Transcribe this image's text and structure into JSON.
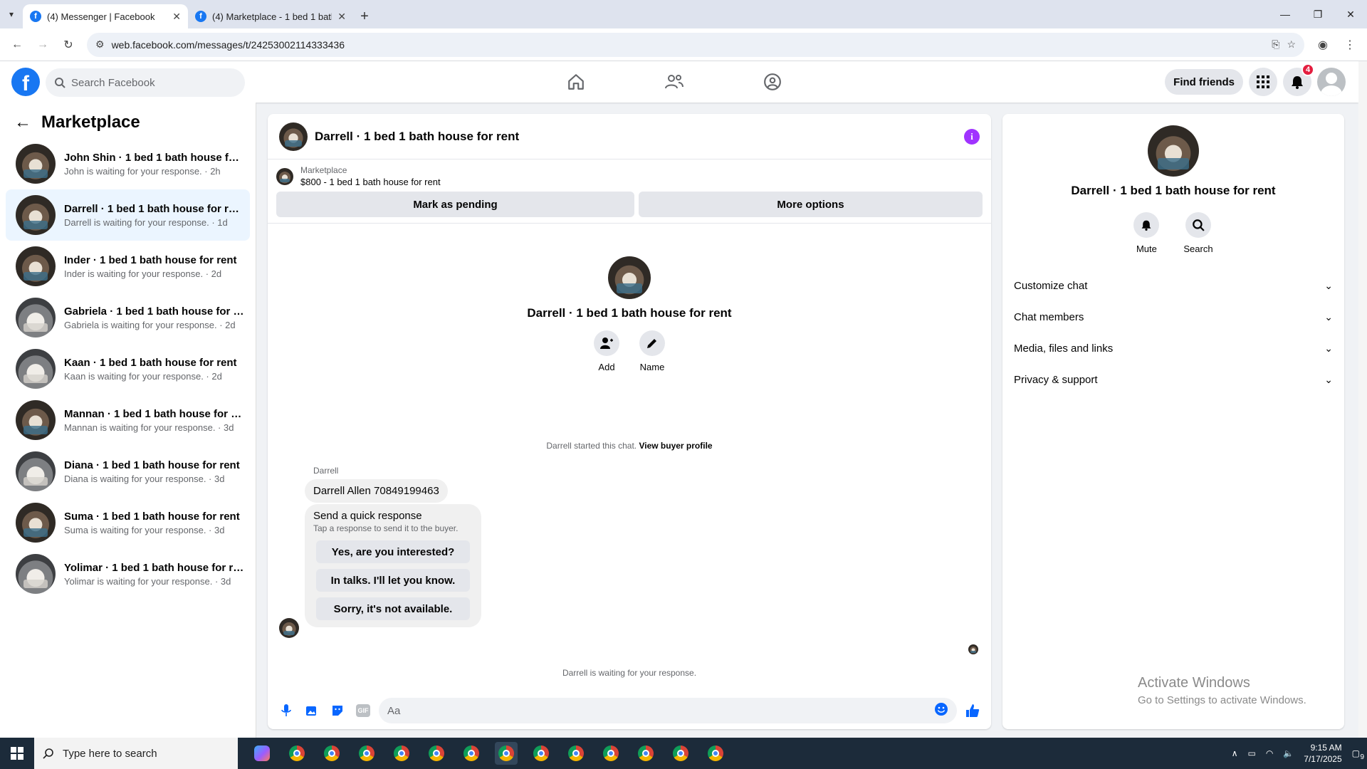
{
  "browser": {
    "tabs": [
      {
        "title": "(4) Messenger | Facebook",
        "active": true
      },
      {
        "title": "(4) Marketplace - 1 bed 1 bath",
        "active": false
      }
    ],
    "url": "web.facebook.com/messages/t/24253002114333436"
  },
  "header": {
    "search_placeholder": "Search Facebook",
    "find_friends": "Find friends",
    "notification_count": "4"
  },
  "sidebar": {
    "title": "Marketplace",
    "conversations": [
      {
        "name": "John Shin · 1 bed 1 bath house for ...",
        "sub": "John is waiting for your response. · 2h"
      },
      {
        "name": "Darrell · 1 bed 1 bath house for rent",
        "sub": "Darrell is waiting for your response. · 1d"
      },
      {
        "name": "Inder · 1 bed 1 bath house for rent",
        "sub": "Inder is waiting for your response. · 2d"
      },
      {
        "name": "Gabriela · 1 bed 1 bath house for r...",
        "sub": "Gabriela is waiting for your response. · 2d"
      },
      {
        "name": "Kaan · 1 bed 1 bath house for rent",
        "sub": "Kaan is waiting for your response. · 2d"
      },
      {
        "name": "Mannan · 1 bed 1 bath house for re...",
        "sub": "Mannan is waiting for your response. · 3d"
      },
      {
        "name": "Diana · 1 bed 1 bath house for rent",
        "sub": "Diana is waiting for your response. · 3d"
      },
      {
        "name": "Suma · 1 bed 1 bath house for rent",
        "sub": "Suma is waiting for your response. · 3d"
      },
      {
        "name": "Yolimar · 1 bed 1 bath house for rent",
        "sub": "Yolimar is waiting for your response. · 3d"
      }
    ]
  },
  "chat": {
    "title": "Darrell · 1 bed 1 bath house for rent",
    "marketplace_label": "Marketplace",
    "listing": "$800 - 1 bed 1 bath house for rent",
    "mark_pending": "Mark as pending",
    "more_options": "More options",
    "intro_name": "Darrell · 1 bed 1 bath house for rent",
    "add_label": "Add",
    "name_label": "Name",
    "started_text": "Darrell started this chat.",
    "view_profile": "View buyer profile",
    "sender": "Darrell",
    "message": "Darrell Allen 70849199463",
    "quick_title": "Send a quick response",
    "quick_sub": "Tap a response to send it to the buyer.",
    "quick_options": [
      "Yes, are you interested?",
      "In talks. I'll let you know.",
      "Sorry, it's not available."
    ],
    "waiting": "Darrell is waiting for your response.",
    "composer_placeholder": "Aa",
    "gif_label": "GIF"
  },
  "info": {
    "name": "Darrell · 1 bed 1 bath house for rent",
    "mute": "Mute",
    "search": "Search",
    "sections": [
      "Customize chat",
      "Chat members",
      "Media, files and links",
      "Privacy & support"
    ]
  },
  "watermark": {
    "line1": "Activate Windows",
    "line2": "Go to Settings to activate Windows."
  },
  "taskbar": {
    "search_placeholder": "Type here to search",
    "time": "9:15 AM",
    "date": "7/17/2025",
    "notification_count": "9"
  },
  "colors": {
    "brand": "#1877f2",
    "accent": "#0866ff",
    "info": "#a033ff",
    "badge": "#e41e3f"
  }
}
